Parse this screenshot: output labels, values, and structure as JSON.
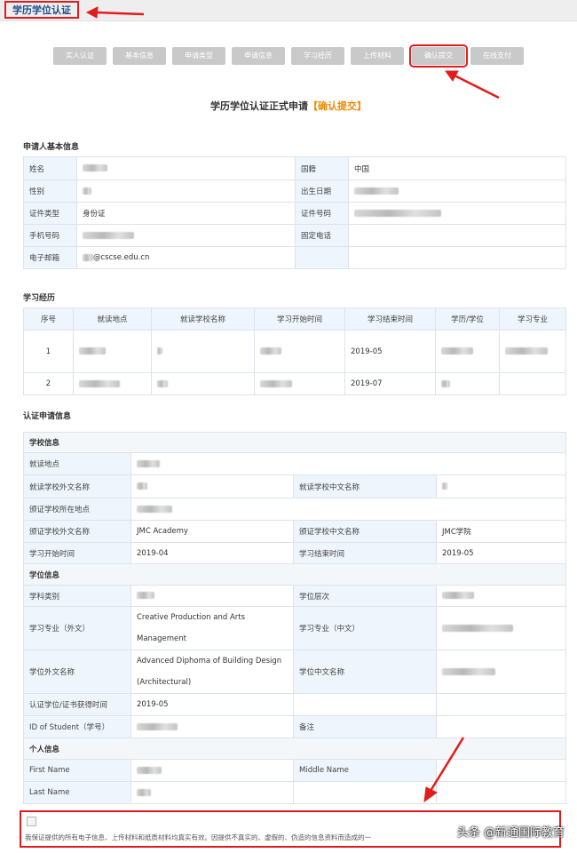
{
  "header": {
    "title": "学历学位认证"
  },
  "steps": [
    "实人认证",
    "基本信息",
    "申请类型",
    "申请信息",
    "学习经历",
    "上传材料",
    "确认提交",
    "在线支付"
  ],
  "form": {
    "title": "学历学位认证正式申请",
    "status": "【确认提交】"
  },
  "applicant": {
    "section": "申请人基本信息",
    "name_label": "姓名",
    "nationality_label": "国籍",
    "nationality": "中国",
    "gender_label": "性别",
    "dob_label": "出生日期",
    "id_type_label": "证件类型",
    "id_type": "身份证",
    "id_no_label": "证件号码",
    "mobile_label": "手机号码",
    "landline_label": "固定电话",
    "email_label": "电子邮箱",
    "email_suffix": "@cscse.edu.cn"
  },
  "education": {
    "section": "学习经历",
    "headers": [
      "序号",
      "就读地点",
      "就读学校名称",
      "学习开始时间",
      "学习结束时间",
      "学历/学位",
      "学习专业"
    ],
    "rows": [
      {
        "index": "1",
        "end": "2019-05"
      },
      {
        "index": "2",
        "end": "2019-07"
      }
    ]
  },
  "cert": {
    "section": "认证申请信息",
    "school_info": "学校信息",
    "study_location_label": "就读地点",
    "school_foreign_label": "就读学校外文名称",
    "school_cn_label": "就读学校中文名称",
    "issuer_location_label": "颁证学校所在地点",
    "issuer_foreign_label": "颁证学校外文名称",
    "issuer_foreign": "JMC Academy",
    "issuer_cn_label": "颁证学校中文名称",
    "issuer_cn": "JMC学院",
    "start_label": "学习开始时间",
    "start": "2019-04",
    "end_label": "学习结束时间",
    "end": "2019-05",
    "degree_info": "学位信息",
    "discipline_label": "学科类别",
    "degree_level_label": "学位层次",
    "major_foreign_label": "学习专业（外文）",
    "major_foreign": "Creative Production and Arts Management",
    "major_cn_label": "学习专业（中文）",
    "degree_foreign_label": "学位外文名称",
    "degree_foreign": "Advanced Diphoma of Building Design (Architectural)",
    "degree_cn_label": "学位中文名称",
    "obtained_label": "认证学位/证书获得时间",
    "obtained": "2019-05",
    "student_id_label": "ID of Student（学号）",
    "remark_label": "备注",
    "personal_info": "个人信息",
    "first_name_label": "First Name",
    "middle_name_label": "Middle Name",
    "last_name_label": "Last Name"
  },
  "confirm": {
    "text": "我保证提供的所有电子信息、上传材料和纸质材料均真实有效。因提供不真实的、虚假的、伪造的信息资料而造成的一"
  },
  "watermark": "头条 @新通国际教育",
  "colors": {
    "accent_red": "#e21c1c",
    "title_blue": "#1f4e8f",
    "status_orange": "#f08a00",
    "label_bg": "#eef5fc"
  }
}
